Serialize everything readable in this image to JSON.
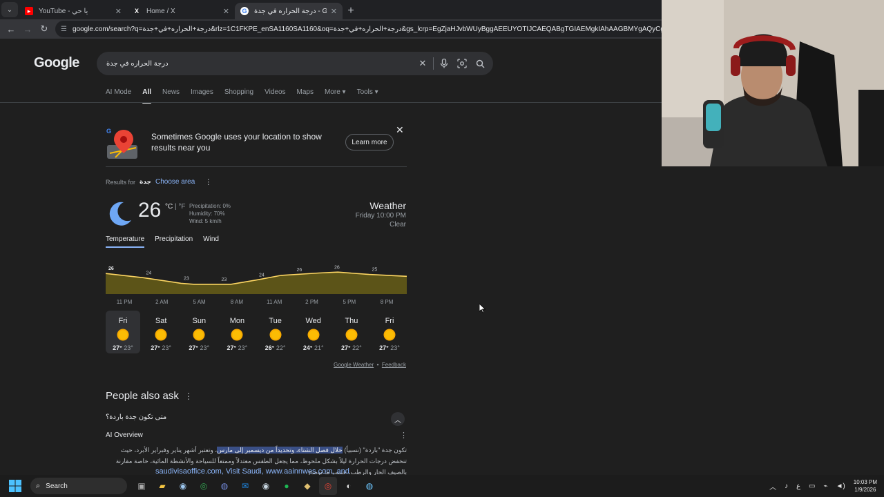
{
  "browser": {
    "tabs": [
      {
        "title": "YouTube - يا حي",
        "favicon": "youtube-icon"
      },
      {
        "title": "Home / X",
        "favicon": "x-icon"
      },
      {
        "title": "درجة الحراره في جدة - Google Search",
        "favicon": "google-icon",
        "active": true
      }
    ],
    "url": "google.com/search?q=درجة+الحراره+في+جدة&rlz=1C1FKPE_enSA1160SA1160&oq=درجة+الحراره+في+جدة&gs_lcrp=EgZjaHJvbWUyBggAEEUYOTIJCAEQABgTGIAEMgkIAhAAGBMYgAQyCggDEAAYExgWGB4yCg"
  },
  "google": {
    "logo": "Google",
    "query": "درجة الحراره في جدة",
    "nav_tabs": [
      "AI Mode",
      "All",
      "News",
      "Images",
      "Shopping",
      "Videos",
      "Maps",
      "More ▾",
      "Tools ▾"
    ],
    "active_tab": "All"
  },
  "location_card": {
    "text": "Sometimes Google uses your location to show results near you",
    "learn_more": "Learn more"
  },
  "results_for": {
    "label": "Results for",
    "place": "جدة",
    "choose_area": "Choose area"
  },
  "weather": {
    "temp": "26",
    "unit_c": "°C",
    "unit_sep": " | ",
    "unit_f": "°F",
    "precipitation": "Precipitation: 0%",
    "humidity": "Humidity: 70%",
    "wind": "Wind: 5 km/h",
    "title": "Weather",
    "datetime": "Friday 10:00 PM",
    "condition": "Clear",
    "tabs": [
      "Temperature",
      "Precipitation",
      "Wind"
    ],
    "footer_source": "Google Weather",
    "footer_sep": "•",
    "footer_feedback": "Feedback",
    "days": [
      {
        "name": "Fri",
        "hi": "27°",
        "lo": "23°",
        "active": true
      },
      {
        "name": "Sat",
        "hi": "27°",
        "lo": "23°"
      },
      {
        "name": "Sun",
        "hi": "27°",
        "lo": "23°"
      },
      {
        "name": "Mon",
        "hi": "27°",
        "lo": "23°"
      },
      {
        "name": "Tue",
        "hi": "26°",
        "lo": "22°"
      },
      {
        "name": "Wed",
        "hi": "24°",
        "lo": "21°"
      },
      {
        "name": "Thu",
        "hi": "27°",
        "lo": "22°"
      },
      {
        "name": "Fri",
        "hi": "27°",
        "lo": "23°"
      }
    ]
  },
  "chart_data": {
    "type": "area",
    "x": [
      "11 PM",
      "2 AM",
      "5 AM",
      "8 AM",
      "11 AM",
      "2 PM",
      "5 PM",
      "8 PM"
    ],
    "label_points": [
      {
        "hour": 0,
        "value": 26
      },
      {
        "hour": 3,
        "value": 24
      },
      {
        "hour": 6,
        "value": 23
      },
      {
        "hour": 9,
        "value": 23
      },
      {
        "hour": 12,
        "value": 24
      },
      {
        "hour": 15,
        "value": 26
      },
      {
        "hour": 18,
        "value": 26
      },
      {
        "hour": 21,
        "value": 25
      }
    ],
    "curve": [
      [
        0,
        25.4
      ],
      [
        3,
        24.5
      ],
      [
        6,
        23.3
      ],
      [
        7,
        23.1
      ],
      [
        10,
        23.1
      ],
      [
        12,
        24.0
      ],
      [
        14,
        25.0
      ],
      [
        17,
        25.5
      ],
      [
        18.5,
        25.7
      ],
      [
        21,
        25.2
      ],
      [
        24,
        24.8
      ]
    ],
    "ylim": [
      21,
      27.5
    ],
    "colors": {
      "line": "#fdd663",
      "fill": "#5c5418"
    }
  },
  "people_also_ask": {
    "title": "People also ask",
    "question": "متى تكون جدة باردة؟",
    "ai_overview": "AI Overview",
    "answer_pre": "تكون جدة \"باردة\" (نسبياً) ",
    "answer_mark": "خلال فصل الشتاء، وتحديداً من ديسمبر إلى مارس",
    "answer_post": "، وتعتبر أشهر يناير وفبراير الأبرد، حيث تنخفض درجات الحرارة ليلاً بشكل ملحوظ، مما يجعل الطقس معتدلاً وممتعاً للسياحة والأنشطة المائية، خاصة مقارنة بالصيف الحار والرطب، حسب ما توضح",
    "sources": "saudivisaoffice.com, Visit Saudi, www.aainnwes.com, and"
  },
  "taskbar": {
    "search": "Search",
    "time": "10:03 PM",
    "date": "1/9/2026",
    "lang": "ع"
  }
}
